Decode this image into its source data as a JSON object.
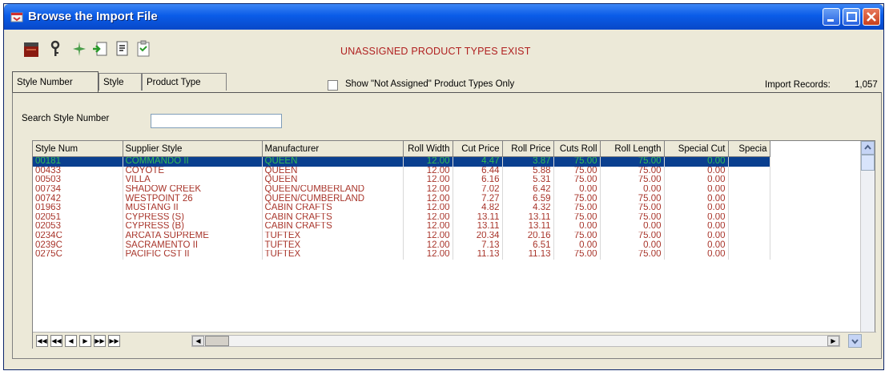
{
  "window": {
    "title": "Browse the Import File"
  },
  "toolbar": {
    "icons": [
      "cabinet-icon",
      "key-icon",
      "sparkle-icon",
      "import-icon",
      "print-icon",
      "clipboard-icon"
    ],
    "warning": "UNASSIGNED PRODUCT TYPES EXIST"
  },
  "tabs": [
    {
      "label": "Style Number",
      "active": true
    },
    {
      "label": "Style",
      "active": false
    },
    {
      "label": "Product Type",
      "active": false
    }
  ],
  "filter": {
    "show_not_assigned_label": "Show \"Not Assigned\" Product Types Only",
    "checked": false
  },
  "records": {
    "label": "Import Records:",
    "value": "1,057"
  },
  "search": {
    "label": "Search Style Number",
    "value": ""
  },
  "grid": {
    "columns": [
      "Style Num",
      "Supplier Style",
      "Manufacturer",
      "Roll Width",
      "Cut Price",
      "Roll Price",
      "Cuts Roll",
      "Roll Length",
      "Special Cut",
      "Specia"
    ],
    "rows": [
      [
        "00181",
        "COMMANDO II",
        "QUEEN",
        "12.00",
        "4.47",
        "3.87",
        "75.00",
        "75.00",
        "0.00",
        ""
      ],
      [
        "00433",
        "COYOTE",
        "QUEEN",
        "12.00",
        "6.44",
        "5.88",
        "75.00",
        "75.00",
        "0.00",
        ""
      ],
      [
        "00503",
        "VILLA",
        "QUEEN",
        "12.00",
        "6.16",
        "5.31",
        "75.00",
        "75.00",
        "0.00",
        ""
      ],
      [
        "00734",
        "SHADOW CREEK",
        "QUEEN/CUMBERLAND",
        "12.00",
        "7.02",
        "6.42",
        "0.00",
        "0.00",
        "0.00",
        ""
      ],
      [
        "00742",
        "WESTPOINT 26",
        "QUEEN/CUMBERLAND",
        "12.00",
        "7.27",
        "6.59",
        "75.00",
        "75.00",
        "0.00",
        ""
      ],
      [
        "01963",
        "MUSTANG II",
        "CABIN CRAFTS",
        "12.00",
        "4.82",
        "4.32",
        "75.00",
        "75.00",
        "0.00",
        ""
      ],
      [
        "02051",
        "CYPRESS (S)",
        "CABIN CRAFTS",
        "12.00",
        "13.11",
        "13.11",
        "75.00",
        "75.00",
        "0.00",
        ""
      ],
      [
        "02053",
        "CYPRESS (B)",
        "CABIN CRAFTS",
        "12.00",
        "13.11",
        "13.11",
        "0.00",
        "0.00",
        "0.00",
        ""
      ],
      [
        "0234C",
        "ARCATA SUPREME",
        "TUFTEX",
        "12.00",
        "20.34",
        "20.16",
        "75.00",
        "75.00",
        "0.00",
        ""
      ],
      [
        "0239C",
        "SACRAMENTO II",
        "TUFTEX",
        "12.00",
        "7.13",
        "6.51",
        "0.00",
        "0.00",
        "0.00",
        ""
      ],
      [
        "0275C",
        "PACIFIC CST II",
        "TUFTEX",
        "12.00",
        "11.13",
        "11.13",
        "75.00",
        "75.00",
        "0.00",
        ""
      ]
    ]
  }
}
